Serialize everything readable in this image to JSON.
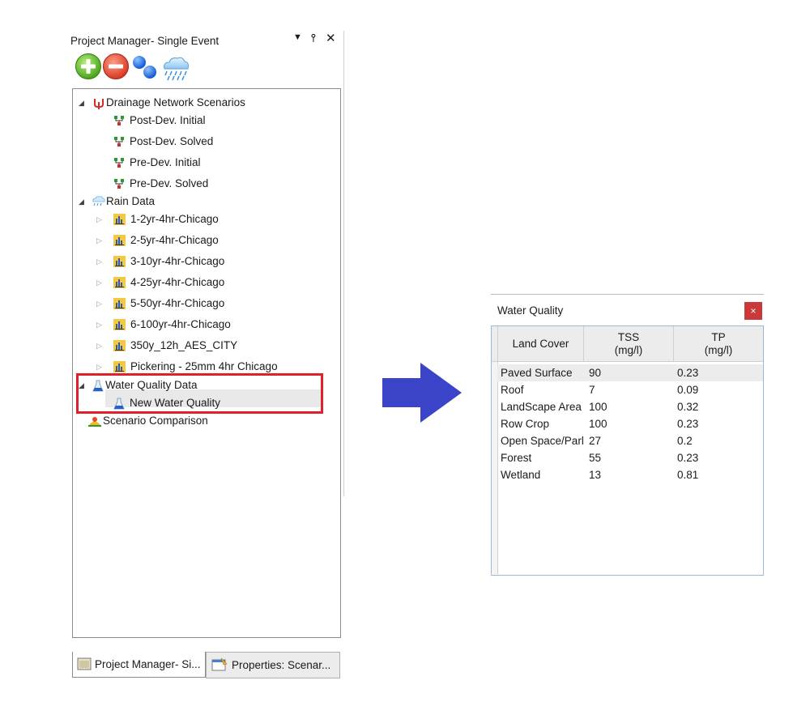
{
  "project_manager": {
    "title": "Project Manager- Single Event",
    "dropdown_icon": "dropdown-arrow-icon",
    "pin_icon": "pin-icon",
    "close_icon": "close-icon",
    "toolbar": [
      "add-icon",
      "remove-icon",
      "bubbles-icon",
      "rain-cloud-icon"
    ],
    "tree": {
      "drainage": {
        "label": "Drainage Network Scenarios",
        "items": [
          "Post-Dev. Initial",
          "Post-Dev. Solved",
          "Pre-Dev. Initial",
          "Pre-Dev. Solved"
        ]
      },
      "rain": {
        "label": "Rain Data",
        "items": [
          "1-2yr-4hr-Chicago",
          "2-5yr-4hr-Chicago",
          "3-10yr-4hr-Chicago",
          "4-25yr-4hr-Chicago",
          "5-50yr-4hr-Chicago",
          "6-100yr-4hr-Chicago",
          "350y_12h_AES_CITY",
          "Pickering - 25mm 4hr Chicago"
        ]
      },
      "water_quality": {
        "label": "Water Quality Data",
        "items": [
          "New Water Quality"
        ]
      },
      "comparison": {
        "label": "Scenario Comparison"
      }
    },
    "tabs": {
      "project_manager": "Project Manager- Si...",
      "properties": "Properties: Scenar..."
    }
  },
  "water_quality_window": {
    "title": "Water Quality",
    "close_label": "×",
    "columns": {
      "land_cover": "Land Cover",
      "tss": [
        "TSS",
        "(mg/l)"
      ],
      "tp": [
        "TP",
        "(mg/l)"
      ]
    },
    "rows": [
      {
        "land_cover": "Paved Surface",
        "tss": "90",
        "tp": "0.23"
      },
      {
        "land_cover": "Roof",
        "tss": "7",
        "tp": "0.09"
      },
      {
        "land_cover": "LandScape Area",
        "tss": "100",
        "tp": "0.32"
      },
      {
        "land_cover": "Row Crop",
        "tss": "100",
        "tp": "0.23"
      },
      {
        "land_cover": "Open Space/Parl",
        "tss": "27",
        "tp": "0.2"
      },
      {
        "land_cover": "Forest",
        "tss": "55",
        "tp": "0.23"
      },
      {
        "land_cover": "Wetland",
        "tss": "13",
        "tp": "0.81"
      }
    ]
  },
  "colors": {
    "highlight_box": "#e0202a",
    "arrow": "#3b44c8",
    "close_button": "#c9393a"
  }
}
